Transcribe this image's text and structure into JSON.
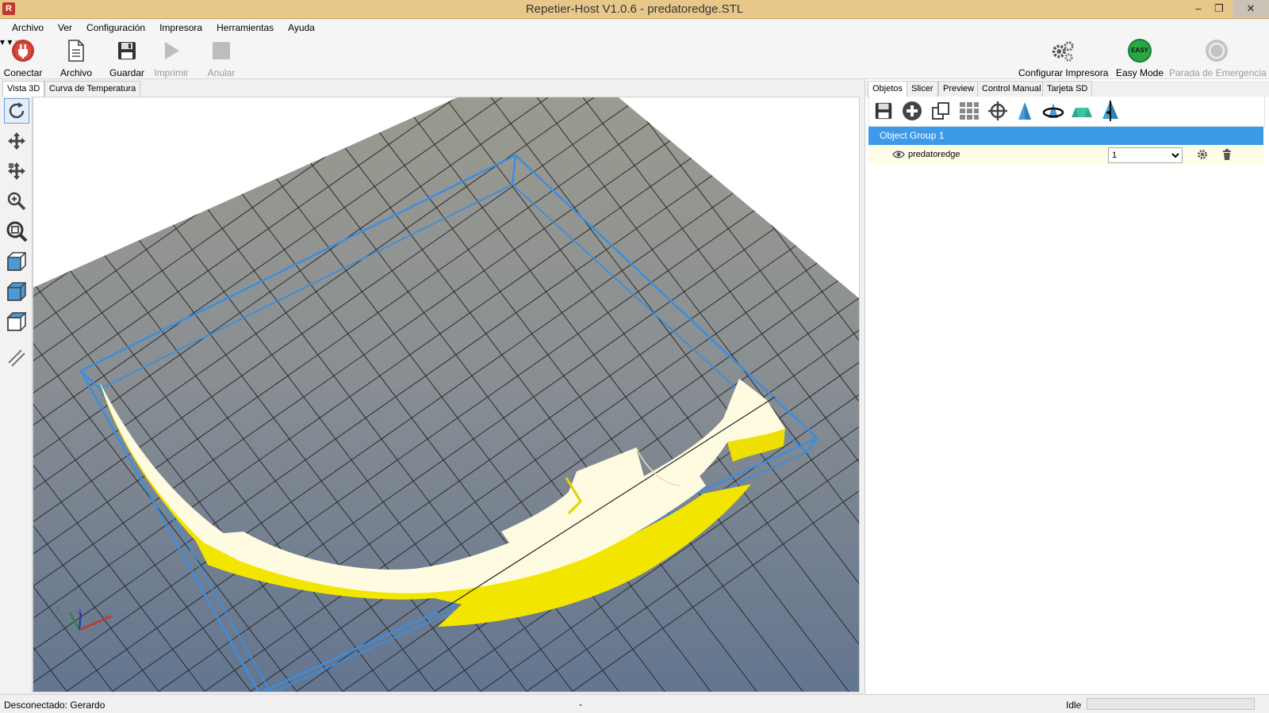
{
  "window": {
    "title": "Repetier-Host V1.0.6 - predatoredge.STL",
    "icon_text": "R",
    "minimize": "–",
    "restore": "❐",
    "close": "✕"
  },
  "menu": [
    "Archivo",
    "Ver",
    "Configuración",
    "Impresora",
    "Herramientas",
    "Ayuda"
  ],
  "toolbar": {
    "connect": "Conectar",
    "file": "Archivo",
    "save": "Guardar",
    "print": "Imprimir",
    "cancel": "Anular",
    "configure_printer": "Configurar Impresora",
    "easy_mode": "Easy Mode",
    "easy_badge": "EASY",
    "emergency_stop": "Parada de Emergencia",
    "dropdown_arrow": "▾"
  },
  "left_tabs": [
    "Vista 3D",
    "Curva de Temperatura"
  ],
  "view_tools": [
    "rotate-icon",
    "move-icon",
    "move-object-icon",
    "zoom-icon",
    "fit-zoom-icon",
    "iso-view-icon",
    "front-view-icon",
    "top-view-icon",
    "parallel-projection-icon"
  ],
  "right_tabs": [
    "Objetos",
    "Slicer",
    "Preview",
    "Control Manual",
    "Tarjeta SD"
  ],
  "objects": {
    "group_name": "Object Group 1",
    "items": [
      {
        "name": "predatoredge",
        "copies": "1"
      }
    ]
  },
  "axes": {
    "x": "x",
    "y": "y",
    "z": "z"
  },
  "colors": {
    "model": "#ffff33",
    "bbox": "#3a8ee0",
    "bed": "#7c8796",
    "selection": "#3d9ae8"
  },
  "status": {
    "connection": "Desconectado: Gerardo",
    "middle": "-",
    "state": "Idle"
  }
}
